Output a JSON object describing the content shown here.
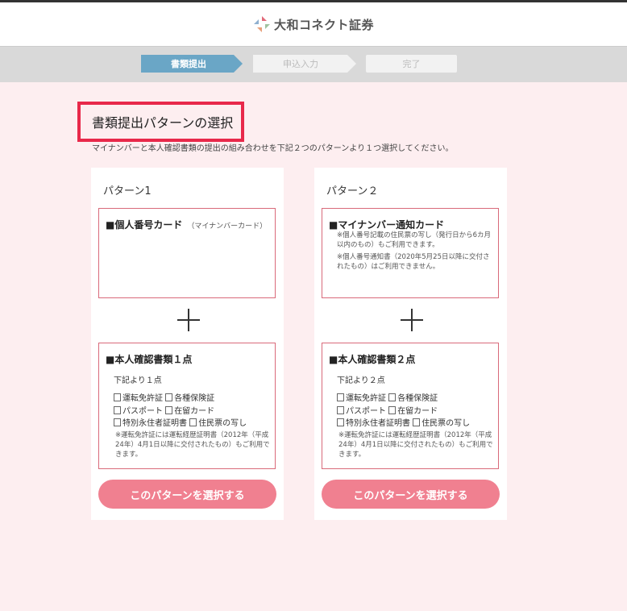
{
  "header": {
    "brand": "大和コネクト証券"
  },
  "steps": [
    {
      "label": "書類提出",
      "active": true
    },
    {
      "label": "申込入力",
      "active": false
    },
    {
      "label": "完了",
      "active": false
    }
  ],
  "page": {
    "title": "書類提出パターンの選択",
    "description": "マイナンバーと本人確認書類の提出の組み合わせを下記２つのパターンより１つ選択してください。"
  },
  "patterns": [
    {
      "title": "パターン1",
      "doc1": {
        "heading": "■個人番号カード",
        "sub": "（マイナンバーカード）",
        "notes": []
      },
      "doc2": {
        "heading": "■本人確認書類１点",
        "below": "下記より１点",
        "checks": [
          [
            "運転免許証",
            "各種保険証"
          ],
          [
            "パスポート",
            "在留カード"
          ],
          [
            "特別永住者証明書",
            "住民票の写し"
          ]
        ],
        "note": "※運転免許証には運転経歴証明書（2012年（平成24年）4月1日以降に交付されたもの）もご利用できます。"
      },
      "button": "このパターンを選択する"
    },
    {
      "title": "パターン２",
      "doc1": {
        "heading": "■マイナンバー通知カード",
        "sub": "",
        "notes": [
          "※個人番号記載の住民票の写し（発行日から6カ月以内のもの）もご利用できます。",
          "※個人番号通知書（2020年5月25日以降に交付されたもの）はご利用できません。"
        ]
      },
      "doc2": {
        "heading": "■本人確認書類２点",
        "below": "下記より２点",
        "checks": [
          [
            "運転免許証",
            "各種保険証"
          ],
          [
            "パスポート",
            "在留カード"
          ],
          [
            "特別永住者証明書",
            "住民票の写し"
          ]
        ],
        "note": "※運転免許証には運転経歴証明書（2012年（平成24年）4月1日以降に交付されたもの）もご利用できます。"
      },
      "button": "このパターンを選択する"
    }
  ],
  "colors": {
    "accent": "#f08090",
    "highlight": "#e8284a",
    "step_active": "#6aa6c6",
    "background": "#fdeef0"
  }
}
